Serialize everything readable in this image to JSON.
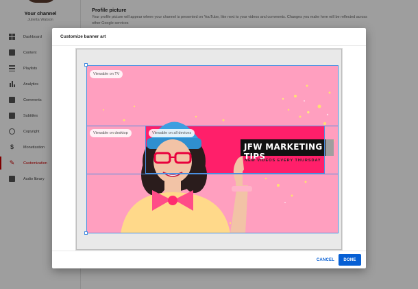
{
  "sidebar": {
    "channel_title": "Your channel",
    "channel_name": "Julietta Watson",
    "items": [
      {
        "label": "Dashboard",
        "icon": "dashboard-icon"
      },
      {
        "label": "Content",
        "icon": "content-icon"
      },
      {
        "label": "Playlists",
        "icon": "playlists-icon"
      },
      {
        "label": "Analytics",
        "icon": "analytics-icon"
      },
      {
        "label": "Comments",
        "icon": "comments-icon"
      },
      {
        "label": "Subtitles",
        "icon": "subtitles-icon"
      },
      {
        "label": "Copyright",
        "icon": "copyright-icon"
      },
      {
        "label": "Monetization",
        "icon": "dollar-icon"
      },
      {
        "label": "Customization",
        "icon": "brush-icon",
        "active": true
      },
      {
        "label": "Audio library",
        "icon": "audio-library-icon"
      }
    ]
  },
  "main": {
    "section_title": "Profile picture",
    "section_desc": "Your profile picture will appear where your channel is presented on YouTube, like next to your videos and comments. Changes you make here will be reflected across other Google services"
  },
  "dialog": {
    "title": "Customize banner art",
    "cancel_label": "CANCEL",
    "done_label": "DONE"
  },
  "banner": {
    "area_labels": {
      "tv": "Viewable on TV",
      "desktop": "Viewable on desktop",
      "all_devices": "Viewable on all devices"
    },
    "headline": "JFW MARKETING TIPS",
    "subheadline": "NEW VIDEOS EVERY THURSDAY"
  },
  "colors": {
    "accent_blue": "#065fd4",
    "guide_blue": "#4a90e2",
    "banner_pink": "#ff9fbf",
    "strip_pink": "#ff1f6a",
    "active_red": "#cc0000"
  }
}
